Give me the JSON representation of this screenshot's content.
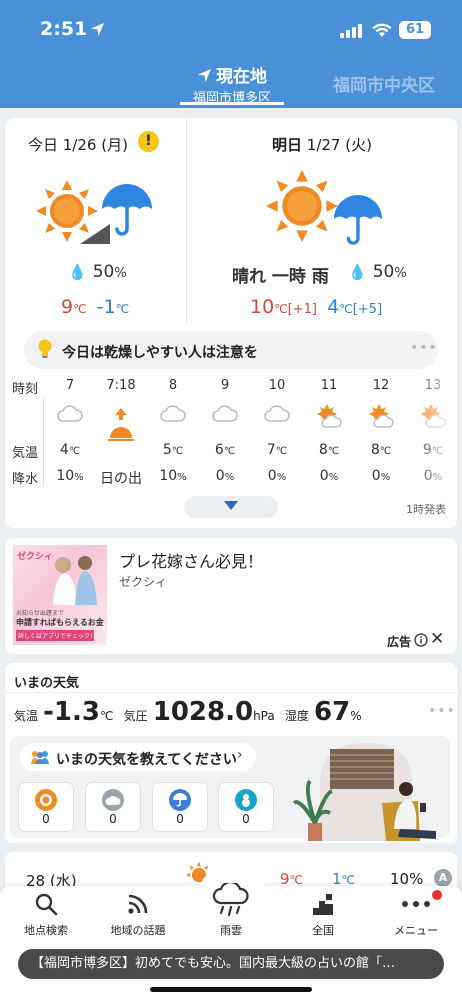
{
  "status": {
    "time": "2:51",
    "battery": "61"
  },
  "header": {
    "current_tab": {
      "label": "現在地",
      "sub": "福岡市博多区"
    },
    "other_tab": "福岡市中央区"
  },
  "today": {
    "title": "今日 1/26 (月)",
    "warning_mark": "!",
    "pop": "50",
    "pop_unit": "%",
    "hi": "9",
    "lo": "-1",
    "unit": "℃"
  },
  "tomorrow": {
    "title": "明日 1/27 (火)",
    "weather": "晴れ 一時 雨",
    "pop": "50",
    "pop_unit": "%",
    "hi": "10",
    "hi_diff": "[+1]",
    "lo": "4",
    "lo_diff": "[+5]",
    "unit": "℃"
  },
  "advice": {
    "text": "今日は乾燥しやすい人は注意を",
    "more": "•••"
  },
  "hourly": {
    "labels": {
      "time": "時刻",
      "temp": "気温",
      "pop": "降水"
    },
    "columns": [
      {
        "hour": "7",
        "icon": "cloudy-icon",
        "temp": "4",
        "pop": "10"
      },
      {
        "hour": "7:18",
        "icon": "sunrise-icon",
        "temp": "",
        "pop": "",
        "note": "日の出"
      },
      {
        "hour": "8",
        "icon": "cloudy-icon",
        "temp": "5",
        "pop": "10"
      },
      {
        "hour": "9",
        "icon": "cloudy-icon",
        "temp": "6",
        "pop": "0"
      },
      {
        "hour": "10",
        "icon": "cloudy-icon",
        "temp": "7",
        "pop": "0"
      },
      {
        "hour": "11",
        "icon": "sun-cloud-icon",
        "temp": "8",
        "pop": "0"
      },
      {
        "hour": "12",
        "icon": "sun-cloud-icon",
        "temp": "8",
        "pop": "0"
      },
      {
        "hour": "13",
        "icon": "sun-cloud-icon",
        "temp": "9",
        "pop": "0"
      }
    ],
    "temp_unit": "℃",
    "pop_unit": "%",
    "issued": "1時発表"
  },
  "ad": {
    "title": "プレ花嫁さん必見！",
    "sponsor": "ゼクシィ",
    "label": "広告",
    "image_text": {
      "brand": "ゼクシィ",
      "line1": "お知らせ出題まで",
      "line2": "申請すればもらえるお金",
      "line3": "詳しくはアプリでチェック!"
    }
  },
  "now": {
    "title": "いまの天気",
    "temp_label": "気温",
    "temp": "-1.3",
    "temp_unit": "℃",
    "pressure_label": "気圧",
    "pressure": "1028.0",
    "pressure_unit": "hPa",
    "humidity_label": "湿度",
    "humidity": "67",
    "humidity_unit": "%",
    "more": "•••",
    "share_prompt": "いまの天気を教えてください",
    "votes": [
      {
        "icon": "sun-icon",
        "count": "0",
        "color": "#f08a24"
      },
      {
        "icon": "cloud-icon",
        "count": "0",
        "color": "#9aa3ad"
      },
      {
        "icon": "rain-icon",
        "count": "0",
        "color": "#3a7fd5"
      },
      {
        "icon": "snow-icon",
        "count": "0",
        "color": "#1aa3c8"
      }
    ]
  },
  "next_day": {
    "day": "28 (水)",
    "hi": "9",
    "lo": "1",
    "unit": "℃",
    "pop": "10%",
    "badge": "A"
  },
  "nav": [
    {
      "label": "地点検索",
      "icon": "search-icon"
    },
    {
      "label": "地域の話題",
      "icon": "feed-icon"
    },
    {
      "label": "雨雲",
      "icon": "rain-cloud-icon"
    },
    {
      "label": "全国",
      "icon": "chart-bar-icon"
    },
    {
      "label": "メニュー",
      "icon": "more-icon"
    }
  ],
  "ticker": "【福岡市博多区】初めてでも安心。国内最大級の占いの館「…",
  "colors": {
    "header": "#4a90d9",
    "high": "#d9453b",
    "low": "#2e7fd6",
    "sun": "#f08a24"
  }
}
